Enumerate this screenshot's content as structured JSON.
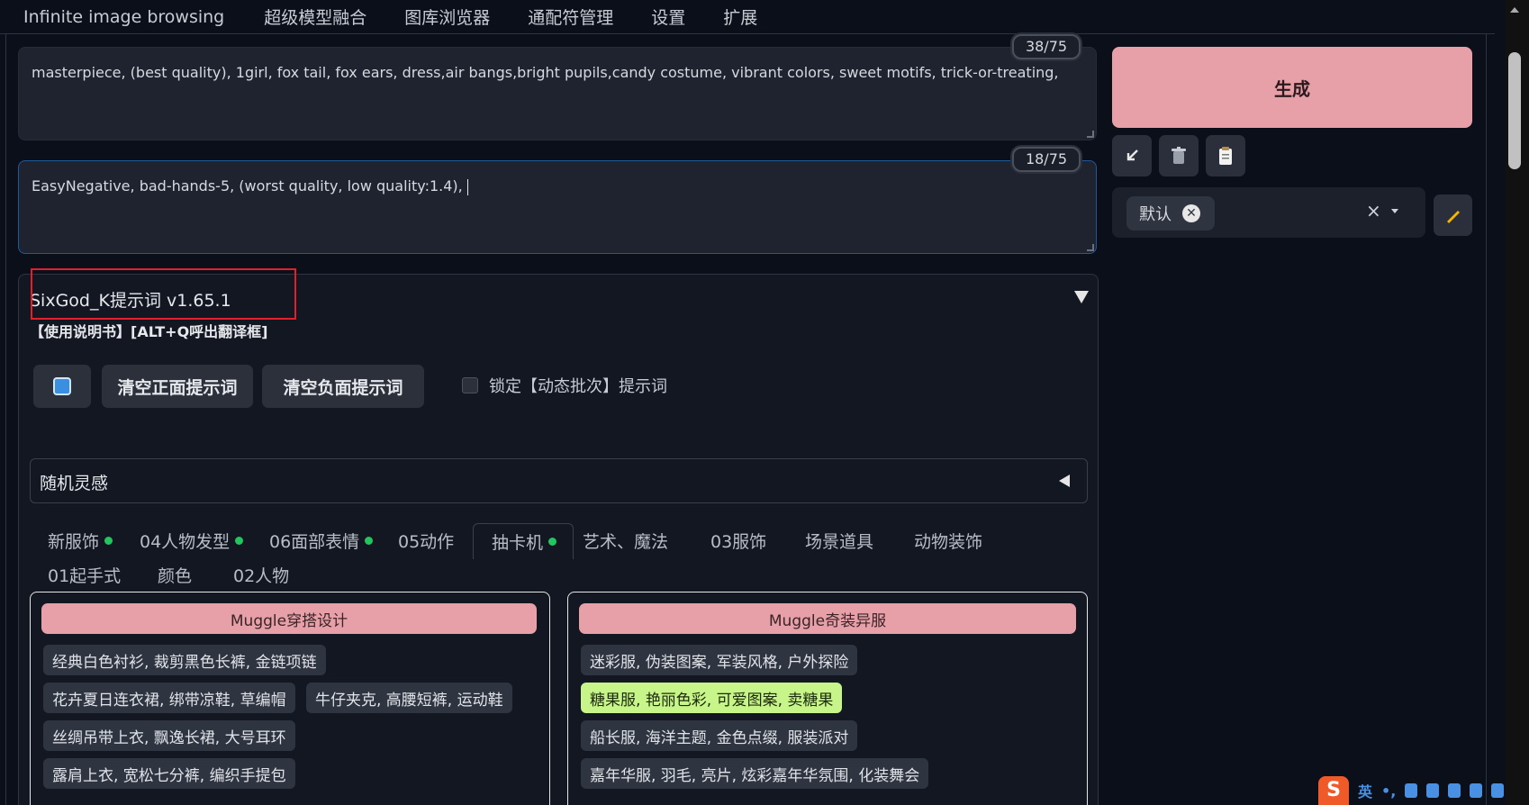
{
  "topnav": {
    "tabs": [
      "Infinite image browsing",
      "超级模型融合",
      "图库浏览器",
      "通配符管理",
      "设置",
      "扩展"
    ]
  },
  "prompts": {
    "positive": {
      "text": "masterpiece, (best quality), 1girl, fox tail, fox ears, dress,air bangs,bright pupils,candy costume, vibrant colors, sweet motifs, trick-or-treating,",
      "token_count": "38/75"
    },
    "negative": {
      "text": "EasyNegative, bad-hands-5, (worst quality, low quality:1.4), ",
      "token_count": "18/75"
    }
  },
  "generate": {
    "label": "生成",
    "tools": {
      "restore_icon": "arrow-down-left-icon",
      "trash_icon": "trash-icon",
      "paste_icon": "clipboard-icon"
    },
    "styles": {
      "chip": "默认",
      "clear_symbol": "×"
    },
    "edit_icon": "pencil-icon"
  },
  "extension": {
    "title": "SixGod_K提示词 v1.65.1",
    "manual": "【使用说明书】[ALT+Q呼出翻译框]",
    "buttons": {
      "refresh_icon": "refresh-icon",
      "clear_positive": "清空正面提示词",
      "clear_negative": "清空负面提示词"
    },
    "lock_label": "锁定【动态批次】提示词",
    "random_label": "随机灵感",
    "tabs_row1": [
      "新服饰",
      "04人物发型",
      "06面部表情",
      "05动作",
      "抽卡机",
      "艺术、魔法",
      "03服饰",
      "场景道具",
      "动物装饰"
    ],
    "tabs_row2": [
      "01起手式",
      "颜色",
      "02人物"
    ],
    "selected_tab": "抽卡机",
    "groups": [
      {
        "title": "Muggle穿搭设计",
        "items": [
          "经典白色衬衫, 裁剪黑色长裤, 金链项链",
          "花卉夏日连衣裙, 绑带凉鞋, 草编帽",
          "牛仔夹克, 高腰短裤, 运动鞋",
          "丝绸吊带上衣, 飘逸长裙, 大号耳环",
          "露肩上衣, 宽松七分裤, 编织手提包"
        ]
      },
      {
        "title": "Muggle奇装异服",
        "items": [
          "迷彩服, 伪装图案, 军装风格, 户外探险",
          "糖果服, 艳丽色彩, 可爱图案, 卖糖果",
          "船长服, 海洋主题, 金色点缀, 服装派对",
          "嘉年华服, 羽毛, 亮片, 炫彩嘉年华氛围, 化装舞会"
        ],
        "highlighted": "糖果服, 艳丽色彩, 可爱图案, 卖糖果"
      }
    ]
  },
  "ime": {
    "logo": "S",
    "lang": "英",
    "punct": "•,",
    "icons": [
      "mic-icon",
      "keyboard-icon",
      "skin-icon",
      "emoji-icon",
      "grid-icon"
    ]
  }
}
